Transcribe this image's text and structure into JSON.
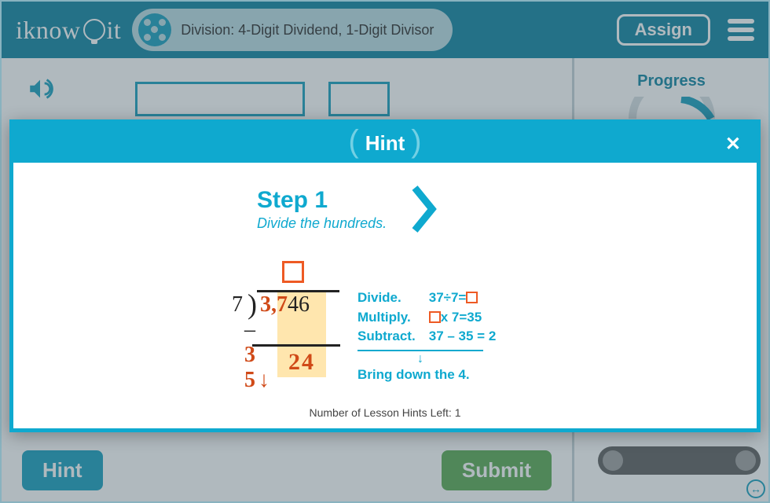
{
  "header": {
    "logo_text_a": "iknow",
    "logo_text_b": "it",
    "lesson_title": "Division: 4-Digit Dividend, 1-Digit Divisor",
    "assign_label": "Assign"
  },
  "sidebar": {
    "progress_label": "Progress"
  },
  "buttons": {
    "hint": "Hint",
    "submit": "Submit"
  },
  "modal": {
    "title": "Hint",
    "step_title": "Step 1",
    "step_subtitle": "Divide the hundreds.",
    "divisor": "7",
    "dividend_hot": "3,7",
    "dividend_rest": "46",
    "sub_row": "3 5",
    "result_row": "24",
    "explain": {
      "divide_label": "Divide.",
      "divide_expr_a": "37÷7=",
      "multiply_label": "Multiply.",
      "multiply_expr_b": "x 7=35",
      "subtract_label": "Subtract.",
      "subtract_expr": "37 – 35 = 2",
      "bringdown": "Bring down the 4."
    },
    "footer": "Number of Lesson Hints Left: 1"
  }
}
